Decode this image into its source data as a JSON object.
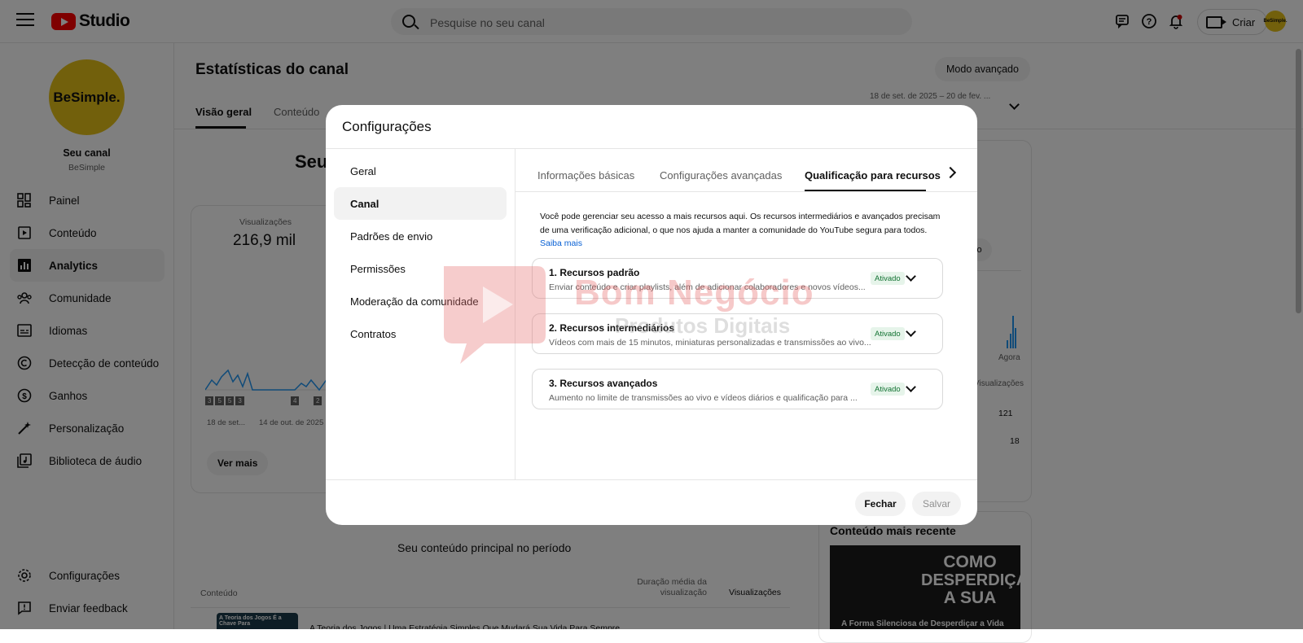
{
  "header": {
    "logo_text": "Studio",
    "search_placeholder": "Pesquise no seu canal",
    "create_label": "Criar",
    "avatar_text": "BeSimple."
  },
  "sidebar": {
    "channel_avatar_text": "BeSimple.",
    "channel_title": "Seu canal",
    "channel_name": "BeSimple",
    "items": [
      {
        "label": "Painel",
        "icon": "dashboard-icon"
      },
      {
        "label": "Conteúdo",
        "icon": "content-icon"
      },
      {
        "label": "Analytics",
        "icon": "analytics-icon",
        "active": true
      },
      {
        "label": "Comunidade",
        "icon": "community-icon"
      },
      {
        "label": "Idiomas",
        "icon": "subtitles-icon"
      },
      {
        "label": "Detecção de conteúdo",
        "icon": "copyright-icon"
      },
      {
        "label": "Ganhos",
        "icon": "dollar-icon"
      },
      {
        "label": "Personalização",
        "icon": "magic-wand-icon"
      },
      {
        "label": "Biblioteca de áudio",
        "icon": "audio-library-icon"
      }
    ],
    "bottom_items": [
      {
        "label": "Configurações",
        "icon": "gear-icon"
      },
      {
        "label": "Enviar feedback",
        "icon": "feedback-icon"
      }
    ]
  },
  "main": {
    "page_title": "Estatísticas do canal",
    "advanced_mode_label": "Modo avançado",
    "date_range": "18 de set. de 2025 – 20 de fev. ...",
    "tabs": [
      "Visão geral",
      "Conteúdo"
    ],
    "headline_partial": "Seu",
    "views_label": "Visualizações",
    "views_value": "216,9 mil",
    "chart_markers": [
      "3",
      "5",
      "5",
      "3",
      "4",
      "2"
    ],
    "x_labels": [
      "18 de set...",
      "14 de out. de 2025"
    ],
    "see_more_label": "Ver mais",
    "top_content_title": "Seu conteúdo principal no período",
    "table_headers": [
      "Conteúdo",
      "Duração média da visualização",
      "Visualizações"
    ],
    "first_row_title": "A Teoria dos Jogos | Uma Estratégia Simples Que Mudará Sua Vida Para Sempre",
    "right_now_label": "Agora",
    "right_views_label": "Visualizações",
    "right_values": [
      "121",
      "18"
    ],
    "right_btn_partial": "vo",
    "recent_content_title": "Conteúdo mais recente",
    "recent_thumb_line1": "COMO",
    "recent_thumb_line2": "DESPERDIÇAR",
    "recent_thumb_line3": "A SUA",
    "recent_thumb_caption": "A Forma Silenciosa de Desperdiçar a Vida",
    "first_thumb_text": "A Teoria dos Jogos É a Chave Para"
  },
  "modal": {
    "title": "Configurações",
    "nav": [
      "Geral",
      "Canal",
      "Padrões de envio",
      "Permissões",
      "Moderação da comunidade",
      "Contratos"
    ],
    "active_nav": "Canal",
    "tabs": [
      "Informações básicas",
      "Configurações avançadas",
      "Qualificação para recursos"
    ],
    "description": "Você pode gerenciar seu acesso a mais recursos aqui. Os recursos intermediários e avançados precisam de uma verificação adicional, o que nos ajuda a manter a comunidade do YouTube segura para todos.",
    "learn_more": "Saiba mais",
    "resources": [
      {
        "title": "1. Recursos padrão",
        "desc": "Enviar conteúdo e criar playlists, além de adicionar colaboradores e novos vídeos...",
        "status": "Ativado"
      },
      {
        "title": "2. Recursos intermediários",
        "desc": "Vídeos com mais de 15 minutos, miniaturas personalizadas e transmissões ao vivo...",
        "status": "Ativado"
      },
      {
        "title": "3. Recursos avançados",
        "desc": "Aumento no limite de transmissões ao vivo e vídeos diários e qualificação para ...",
        "status": "Ativado"
      }
    ],
    "close_label": "Fechar",
    "save_label": "Salvar"
  },
  "watermark": {
    "line1": "Bom Negócio",
    "line2": "Produtos Digitais"
  }
}
